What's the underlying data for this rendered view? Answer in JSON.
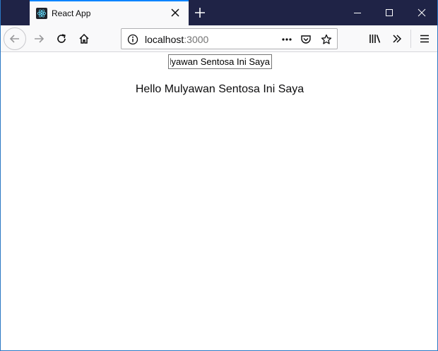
{
  "browser": {
    "tab_title": "React App",
    "url_host": "localhost",
    "url_port": ":3000"
  },
  "icons": {
    "favicon": "react-logo-icon",
    "tab_close": "close-icon",
    "new_tab": "plus-icon",
    "minimize": "minimize-icon",
    "maximize": "maximize-icon",
    "close_window": "close-icon",
    "back": "arrow-left-icon",
    "forward": "arrow-right-icon",
    "reload": "reload-icon",
    "home": "home-icon",
    "site_info": "info-icon",
    "page_actions": "ellipsis-icon",
    "pocket": "pocket-icon",
    "bookmark": "star-icon",
    "library": "library-icon",
    "overflow": "chevron-double-right-icon",
    "menu": "hamburger-icon"
  },
  "colors": {
    "tabstrip": "#1f2346",
    "active_tab_accent": "#0a84ff",
    "toolbar": "#f9f9fa"
  },
  "page": {
    "input_value": "Hello Mulyawan Sentosa Ini Saya",
    "greeting": "Hello Mulyawan Sentosa Ini Saya"
  }
}
